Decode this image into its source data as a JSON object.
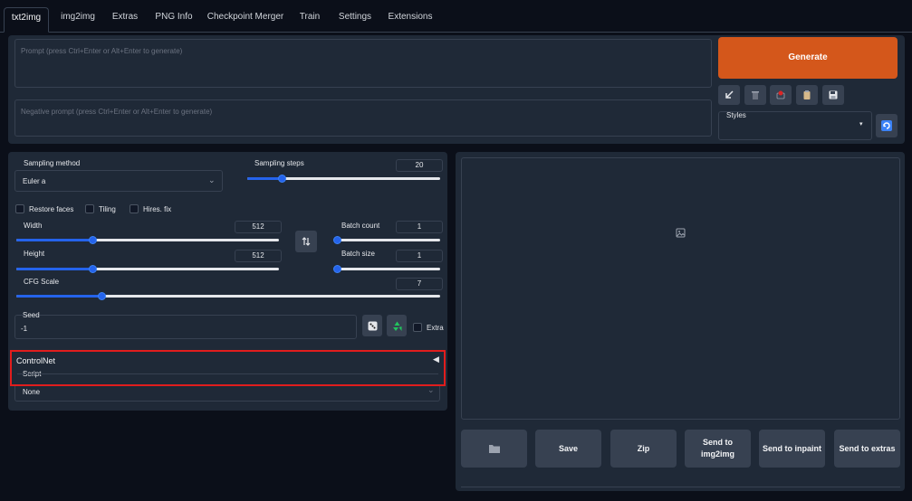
{
  "tabs": [
    {
      "label": "txt2img",
      "active": true
    },
    {
      "label": "img2img"
    },
    {
      "label": "Extras"
    },
    {
      "label": "PNG Info"
    },
    {
      "label": "Checkpoint Merger"
    },
    {
      "label": "Train"
    },
    {
      "label": "Settings"
    },
    {
      "label": "Extensions"
    }
  ],
  "prompt": {
    "placeholder": "Prompt (press Ctrl+Enter or Alt+Enter to generate)"
  },
  "negative_prompt": {
    "placeholder": "Negative prompt (press Ctrl+Enter or Alt+Enter to generate)"
  },
  "generate_label": "Generate",
  "styles": {
    "label": "Styles",
    "value": ""
  },
  "sampling": {
    "method_label": "Sampling method",
    "method_value": "Euler a",
    "steps_label": "Sampling steps",
    "steps_value": "20"
  },
  "options": {
    "restore_faces": "Restore faces",
    "tiling": "Tiling",
    "hires_fix": "Hires. fix"
  },
  "dims": {
    "width_label": "Width",
    "width_value": "512",
    "height_label": "Height",
    "height_value": "512"
  },
  "batch": {
    "count_label": "Batch count",
    "count_value": "1",
    "size_label": "Batch size",
    "size_value": "1"
  },
  "cfg": {
    "label": "CFG Scale",
    "value": "7"
  },
  "seed": {
    "label": "Seed",
    "value": "-1",
    "extra_label": "Extra"
  },
  "controlnet": {
    "label": "ControlNet",
    "script_label": "Script"
  },
  "script": {
    "value": "None"
  },
  "result_buttons": {
    "save": "Save",
    "zip": "Zip",
    "send_img2img": "Send to img2img",
    "send_inpaint": "Send to inpaint",
    "send_extras": "Send to extras"
  },
  "slider_levels": {
    "sampling_steps": 0.18,
    "width": 0.29,
    "height": 0.29,
    "batch_count": 0.0,
    "batch_size": 0.0,
    "cfg_scale": 0.2
  },
  "colors": {
    "accent": "#d4571b",
    "slider": "#2563eb",
    "highlight": "#e11d1d",
    "background": "#0b0f19",
    "panel": "#1f2937"
  }
}
